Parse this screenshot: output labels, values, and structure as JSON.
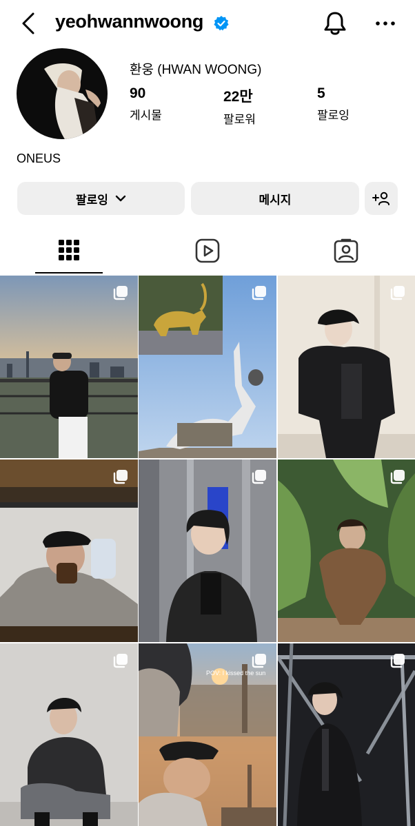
{
  "header": {
    "username": "yeohwannwoong",
    "icons": {
      "back": "back-chevron-icon",
      "verified": "verified-badge-icon",
      "notifications": "bell-icon",
      "more": "more-dots-icon"
    }
  },
  "profile": {
    "display_name": "환웅 (HWAN WOONG)",
    "stats": [
      {
        "value": "90",
        "label": "게시물"
      },
      {
        "value": "22만",
        "label": "팔로워"
      },
      {
        "value": "5",
        "label": "팔로잉"
      }
    ],
    "bio": "ONEUS"
  },
  "actions": {
    "following_label": "팔로잉",
    "message_label": "메시지",
    "add_icon": "add-person-icon"
  },
  "tabs": [
    {
      "name": "posts-grid",
      "icon": "grid-icon",
      "active": true
    },
    {
      "name": "reels",
      "icon": "reels-icon",
      "active": false
    },
    {
      "name": "tagged",
      "icon": "tagged-person-icon",
      "active": false
    }
  ],
  "posts": {
    "caption_overlay": "POV: I kissed the sun",
    "colors": {
      "accent_blue": "#0095f6",
      "button_bg": "#efefef"
    }
  }
}
